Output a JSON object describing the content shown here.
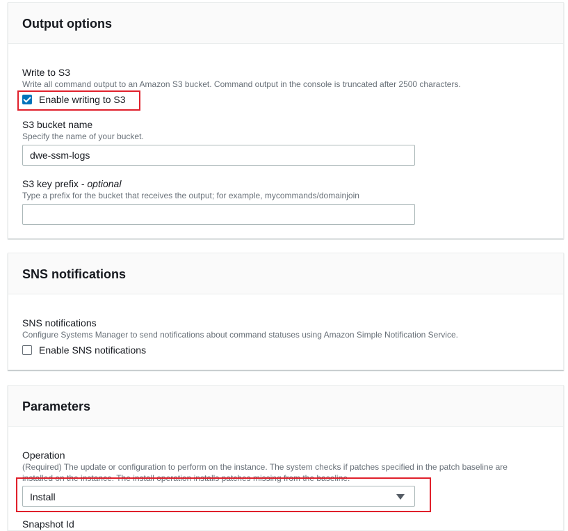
{
  "output_options": {
    "title": "Output options",
    "write_to_s3": {
      "label": "Write to S3",
      "description": "Write all command output to an Amazon S3 bucket. Command output in the console is truncated after 2500 characters.",
      "checkbox_label": "Enable writing to S3",
      "checked": true
    },
    "bucket_name": {
      "label": "S3 bucket name",
      "description": "Specify the name of your bucket.",
      "value": "dwe-ssm-logs"
    },
    "key_prefix": {
      "label": "S3 key prefix",
      "label_suffix": "optional",
      "description": "Type a prefix for the bucket that receives the output; for example, mycommands/domainjoin",
      "value": ""
    }
  },
  "sns": {
    "title": "SNS notifications",
    "label": "SNS notifications",
    "description": "Configure Systems Manager to send notifications about command statuses using Amazon Simple Notification Service.",
    "checkbox_label": "Enable SNS notifications",
    "checked": false
  },
  "parameters": {
    "title": "Parameters",
    "operation": {
      "label": "Operation",
      "description_line1": "(Required) The update or configuration to perform on the instance. The system checks if patches specified in the patch baseline are",
      "description_line2": "installed on the instance. The install operation installs patches missing from the baseline.",
      "selected": "Install"
    },
    "next_label": "Snapshot Id"
  },
  "colors": {
    "accent": "#0073bb",
    "highlight": "#e0202b"
  }
}
